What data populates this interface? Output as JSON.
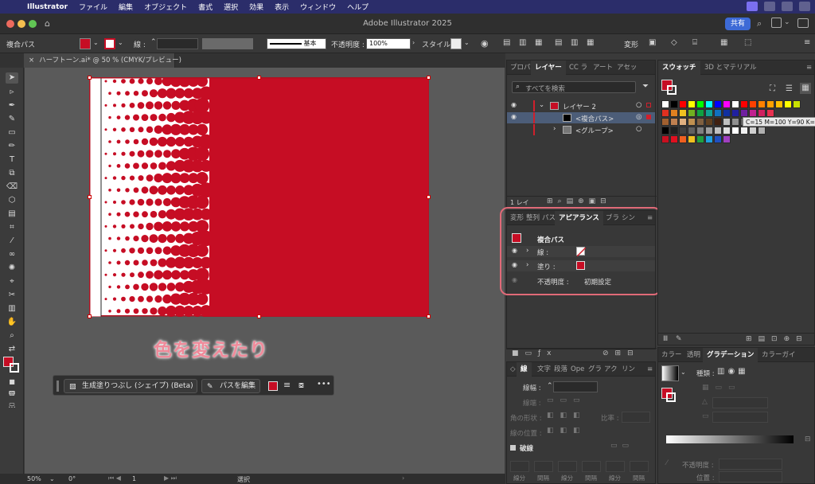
{
  "menubar": {
    "app": "Illustrator",
    "items": [
      "ファイル",
      "編集",
      "オブジェクト",
      "書式",
      "選択",
      "効果",
      "表示",
      "ウィンドウ",
      "ヘルプ"
    ]
  },
  "window": {
    "title": "Adobe Illustrator 2025",
    "share_label": "共有"
  },
  "control_bar": {
    "selection_label": "複合パス",
    "stroke_label": "線 :",
    "stroke_style": "基本",
    "opacity_label": "不透明度 :",
    "opacity_value": "100%",
    "style_label": "スタイル :",
    "transform_label": "変形"
  },
  "document": {
    "tab_label": "ハーフトーン.ai* @ 50 % (CMYK/プレビュー)",
    "overlay_caption": "色を変えたり",
    "artboard_fill": "#c60d24"
  },
  "context_bar": {
    "generative_fill": "生成塗りつぶし (シェイプ) (Beta)",
    "edit_path": "パスを編集",
    "more": "•••"
  },
  "status_bar": {
    "zoom": "50%",
    "rotation": "0°",
    "artboard_num": "1",
    "tool_label": "選択"
  },
  "layers_panel": {
    "tabs": [
      "プロパ",
      "レイヤー",
      "CC ラ",
      "アート",
      "アセッ"
    ],
    "search_placeholder": "すべてを検索",
    "rows": [
      {
        "label": "レイヤー 2"
      },
      {
        "label": "<複合パス>"
      },
      {
        "label": "<グループ>"
      }
    ],
    "footer_label": "1 レイ"
  },
  "appearance_panel": {
    "tabs": [
      "変形",
      "整列",
      "パス",
      "アピアランス",
      "ブラ",
      "シン"
    ],
    "title": "複合パス",
    "stroke_label": "線 :",
    "fill_label": "塗り :",
    "opacity_label": "不透明度 :",
    "opacity_value": "初期設定"
  },
  "stroke_panel": {
    "tabs": [
      "線",
      "文字",
      "段落",
      "Ope",
      "グラ",
      "アク",
      "リン"
    ],
    "weight_label": "線幅 :",
    "miter_label": "線端 :",
    "corner_label": "角の形状 :",
    "limit_label": "比率 :",
    "align_label": "線の位置 :",
    "dashed_label": "破線",
    "dash_cols": [
      "線分",
      "間隔",
      "線分",
      "間隔",
      "線分",
      "間隔"
    ]
  },
  "swatches_panel": {
    "tabs": [
      "スウォッチ",
      "3D とマテリアル"
    ],
    "tooltip": "C=15 M=100 Y=90 K=10",
    "row1": [
      "#ffffff",
      "#000000",
      "#ff0000",
      "#ffff00",
      "#00ff00",
      "#00ffff",
      "#0000ff",
      "#ff00ff",
      "#ffffff",
      "#ff0000",
      "#ff4000",
      "#ff8000",
      "#ffa000",
      "#ffc000",
      "#ffff00",
      "#c8e000"
    ],
    "row2": [
      "#e03020",
      "#e08020",
      "#f0c020",
      "#70b020",
      "#10a040",
      "#10a090",
      "#1070c0",
      "#1030a0",
      "#2020a0",
      "#7020a0",
      "#c0208f",
      "#d02060",
      "#e83050"
    ],
    "row3": [
      "#a06030",
      "#c08050",
      "#e0b080",
      "#c09050",
      "#806040",
      "#604020",
      "#402010",
      "#c0c0c0",
      "#909090",
      "#606060",
      "#404040",
      "#202020",
      "#ffffff"
    ],
    "row4": [
      "#000000",
      "#202020",
      "#404040",
      "#606060",
      "#808080",
      "#a0a0a0",
      "#c0c0c0",
      "#e0e0e0",
      "#ffffff",
      "#f0f0f0",
      "#d0d0d0",
      "#b0b0b0"
    ],
    "row5": [
      "#c81020",
      "#e01020",
      "#f06020",
      "#f0c020",
      "#20a040",
      "#20a0e0",
      "#2050c0",
      "#a040c0"
    ]
  },
  "gradient_panel": {
    "tabs": [
      "カラー",
      "透明",
      "グラデーション",
      "カラーガイ"
    ],
    "type_label": "種類 :",
    "opacity_label": "不透明度 :",
    "position_label": "位置 :"
  }
}
